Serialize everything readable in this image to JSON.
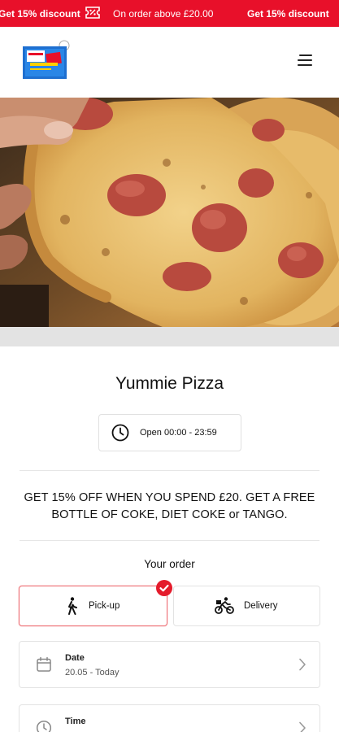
{
  "promo_bar": {
    "left_text": "Get 15% discount",
    "center_text": "On order above £20.00",
    "right_text": "Get 15% discount",
    "ticket_icon": "ticket-icon"
  },
  "header": {
    "logo_icon": "restaurant-logo",
    "menu_icon": "hamburger-menu-icon"
  },
  "hero": {
    "image": "pizza-photo"
  },
  "store": {
    "name": "Yummie Pizza",
    "hours": "Open 00:00 - 23:59",
    "promo": "GET 15% OFF WHEN YOU SPEND £20. GET A FREE BOTTLE OF COKE, DIET COKE or TANGO."
  },
  "order": {
    "heading": "Your order",
    "options": [
      {
        "label": "Pick-up",
        "icon": "walking-person-icon",
        "selected": true
      },
      {
        "label": "Delivery",
        "icon": "bicycle-courier-icon",
        "selected": false
      }
    ],
    "date": {
      "title": "Date",
      "value": "20.05 - Today",
      "icon": "calendar-icon"
    },
    "time": {
      "title": "Time",
      "value": "",
      "icon": "clock-icon"
    }
  },
  "colors": {
    "accent": "#e8102a",
    "selected_border": "#ee6e74",
    "badge": "#e41b2b"
  }
}
